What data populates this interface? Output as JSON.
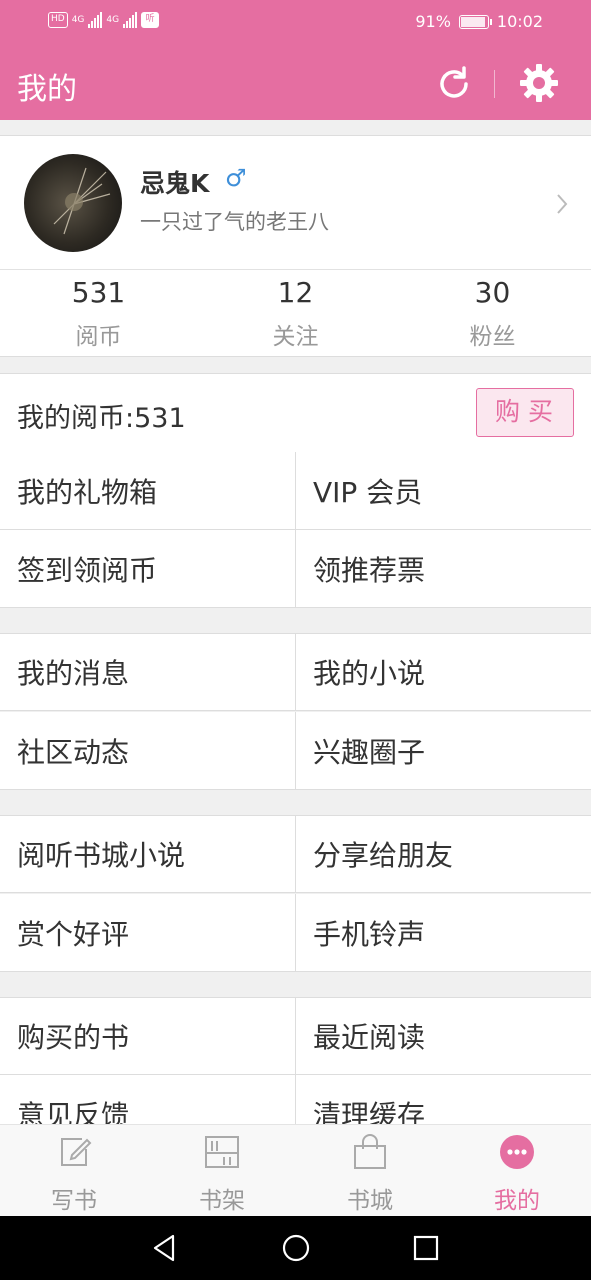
{
  "status_bar": {
    "left_badges": [
      "HD",
      "4G",
      "4G",
      "听"
    ],
    "battery": "91%",
    "time": "10:02"
  },
  "header": {
    "title": "我的",
    "refresh_icon": "refresh-icon",
    "settings_icon": "gear-icon"
  },
  "profile": {
    "name": "忌鬼K",
    "gender_symbol": "♂",
    "bio": "一只过了气的老王八",
    "stats": [
      {
        "value": "531",
        "label": "阅币"
      },
      {
        "value": "12",
        "label": "关注"
      },
      {
        "value": "30",
        "label": "粉丝"
      }
    ]
  },
  "coins": {
    "label": "我的阅币:531",
    "buy_label": "购买"
  },
  "menu": [
    [
      "我的礼物箱",
      "VIP 会员"
    ],
    [
      "签到领阅币",
      "领推荐票"
    ],
    [
      "我的消息",
      "我的小说"
    ],
    [
      "社区动态",
      "兴趣圈子"
    ],
    [
      "阅听书城小说",
      "分享给朋友"
    ],
    [
      "赏个好评",
      "手机铃声"
    ],
    [
      "购买的书",
      "最近阅读"
    ],
    [
      "意见反馈",
      "清理缓存"
    ]
  ],
  "bottom_nav": [
    {
      "label": "写书",
      "icon": "edit-icon"
    },
    {
      "label": "书架",
      "icon": "bookshelf-icon"
    },
    {
      "label": "书城",
      "icon": "shopping-bag-icon"
    },
    {
      "label": "我的",
      "icon": "more-dots-icon",
      "active": true
    }
  ],
  "colors": {
    "brand_pink": "#e56ea1",
    "gender_blue": "#3e8fd9"
  }
}
